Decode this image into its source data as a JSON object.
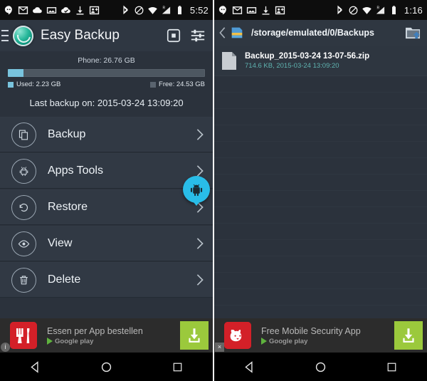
{
  "left_phone": {
    "statusbar": {
      "notification_icons": [
        "hangouts-icon",
        "gmail-icon",
        "cloud-icon",
        "screenshot-icon",
        "cloud-check-icon",
        "download-icon",
        "contact-add-icon"
      ],
      "system_icons": [
        "bluetooth-icon",
        "do-not-disturb-icon",
        "wifi-icon",
        "signal-roaming-icon",
        "battery-icon"
      ],
      "time": "5:52"
    },
    "appbar": {
      "title": "Easy Backup",
      "logo_icon": "easy-backup-logo",
      "menu_icon": "hamburger-icon",
      "action_stop_icon": "stop-record-icon",
      "action_settings_icon": "equalizer-icon"
    },
    "storage": {
      "title": "Phone: 26.76 GB",
      "used_label": "Used: 2.23 GB",
      "free_label": "Free: 24.53 GB",
      "used_percent": 8,
      "bar_fill_color": "#79c4de",
      "bar_track_color": "#4d5761",
      "last_backup": "Last backup on: 2015-03-24 13:09:20"
    },
    "menu_items": [
      {
        "label": "Backup",
        "icon": "copy-files-icon"
      },
      {
        "label": "Apps Tools",
        "icon": "android-robot-icon"
      },
      {
        "label": "Restore",
        "icon": "restore-rotate-icon"
      },
      {
        "label": "View",
        "icon": "eye-icon"
      },
      {
        "label": "Delete",
        "icon": "trash-icon"
      }
    ],
    "fab": {
      "icon": "android-robot-icon",
      "color": "#29bde8"
    },
    "ad": {
      "title": "Essen per App bestellen",
      "store": "Google play",
      "icon": "restaurant-cutlery-icon",
      "badge": "i",
      "cta_icon": "download-icon",
      "cta_color": "#9bc93c"
    },
    "navbar": {
      "back": "back-triangle-icon",
      "home": "home-circle-icon",
      "recents": "recents-square-icon"
    }
  },
  "right_phone": {
    "statusbar": {
      "notification_icons": [
        "hangouts-icon",
        "gmail-icon",
        "screenshot-icon",
        "download-icon",
        "contact-add-icon"
      ],
      "system_icons": [
        "bluetooth-icon",
        "do-not-disturb-icon",
        "wifi-icon",
        "signal-roaming-icon",
        "battery-icon"
      ],
      "time": "1:16"
    },
    "pathbar": {
      "back_icon": "chevron-left-icon",
      "folder_icon": "sd-folder-icon",
      "path": "/storage/emulated/0/Backups",
      "new_folder_icon": "folder-add-icon"
    },
    "files": [
      {
        "name": "Backup_2015-03-24 13-07-56.zip",
        "meta": "714.6 KB, 2015-03-24 13:09:20",
        "icon": "file-document-icon"
      }
    ],
    "ad": {
      "title": "Free Mobile Security App",
      "store": "Google play",
      "icon": "bulldog-icon",
      "badge": "×",
      "cta_icon": "download-icon",
      "cta_color": "#9bc93c"
    },
    "navbar": {
      "back": "back-triangle-icon",
      "home": "home-circle-icon",
      "recents": "recents-square-icon"
    }
  }
}
